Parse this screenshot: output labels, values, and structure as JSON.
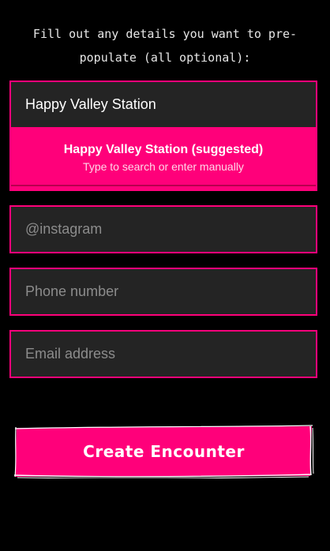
{
  "intro": {
    "text": "Fill out any details you want to pre-populate (all optional):"
  },
  "location": {
    "value": "Happy Valley Station",
    "suggestion_title": "Happy Valley Station (suggested)",
    "suggestion_hint": "Type to search or enter manually"
  },
  "fields": {
    "instagram_placeholder": "@instagram",
    "phone_placeholder": "Phone number",
    "email_placeholder": "Email address"
  },
  "actions": {
    "create_label": "Create Encounter"
  },
  "colors": {
    "accent": "#ff007a",
    "background": "#000000",
    "input_bg": "#242424"
  }
}
